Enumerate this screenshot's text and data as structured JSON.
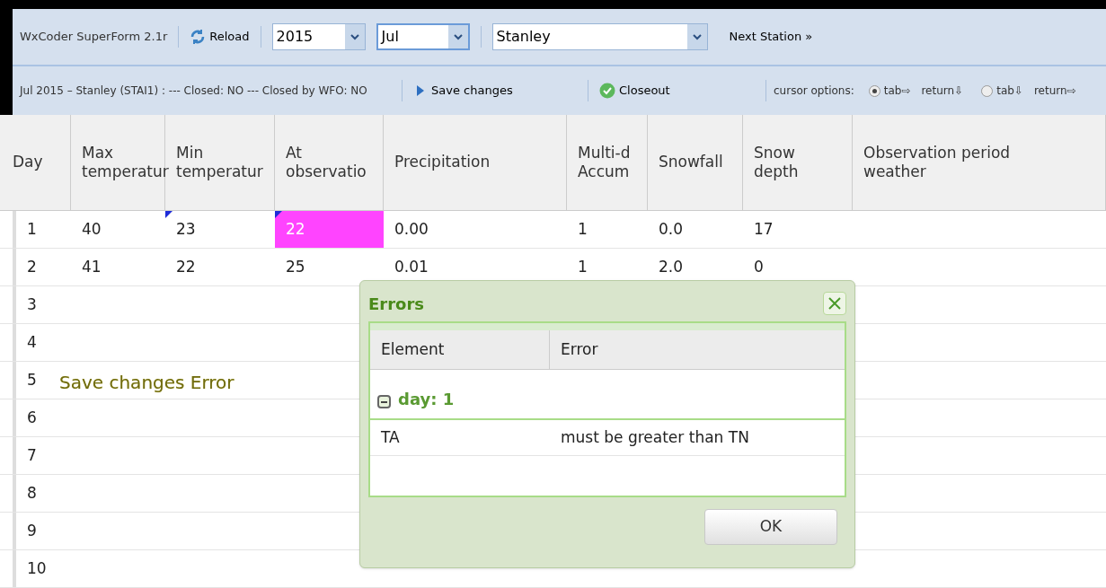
{
  "toolbar": {
    "app_title": "WxCoder SuperForm 2.1r",
    "reload": "Reload",
    "year": "2015",
    "month": "Jul",
    "station": "Stanley",
    "next_station": "Next Station",
    "next_icon": "»"
  },
  "status_bar": {
    "summary": "Jul 2015 – Stanley (STAI1) : --- Closed: NO --- Closed by WFO: NO",
    "save": "Save changes",
    "closeout": "Closeout",
    "cursor_label": "cursor options:",
    "cursor_options": [
      {
        "tab": "tab⇨",
        "return": "return⇩",
        "selected": true
      },
      {
        "tab": "tab⇩",
        "return": "return⇨",
        "selected": false
      }
    ]
  },
  "table": {
    "columns": [
      {
        "line1": "Day"
      },
      {
        "line1": "Max",
        "line2": "temperatur"
      },
      {
        "line1": "Min",
        "line2": "temperatur"
      },
      {
        "line1": "At",
        "line2": "observatio"
      },
      {
        "line1": "Precipitation"
      },
      {
        "line1": "Multi-d",
        "line2": "Accum"
      },
      {
        "line1": "Snowfall"
      },
      {
        "line1": "Snow",
        "line2": "depth"
      },
      {
        "line1": "Observation period",
        "line2": "weather"
      }
    ],
    "rows": [
      {
        "day": "1",
        "cells": [
          {
            "value": "40",
            "modified": false,
            "error": false
          },
          {
            "value": "23",
            "modified": true,
            "error": false
          },
          {
            "value": "22",
            "modified": true,
            "error": true
          },
          {
            "value": "0.00",
            "modified": false,
            "error": false
          },
          {
            "value": "1",
            "modified": false,
            "error": false
          },
          {
            "value": "0.0",
            "modified": false,
            "error": false
          },
          {
            "value": "17",
            "modified": false,
            "error": false
          }
        ]
      },
      {
        "day": "2",
        "cells": [
          {
            "value": "41",
            "modified": false,
            "error": false
          },
          {
            "value": "22",
            "modified": false,
            "error": false
          },
          {
            "value": "25",
            "modified": false,
            "error": false
          },
          {
            "value": "0.01",
            "modified": false,
            "error": false
          },
          {
            "value": "1",
            "modified": false,
            "error": false
          },
          {
            "value": "2.0",
            "modified": false,
            "error": false
          },
          {
            "value": "0",
            "modified": false,
            "error": false
          }
        ]
      },
      {
        "day": "3"
      },
      {
        "day": "4"
      },
      {
        "day": "5"
      },
      {
        "day": "6"
      },
      {
        "day": "7"
      },
      {
        "day": "8"
      },
      {
        "day": "9"
      },
      {
        "day": "10"
      }
    ]
  },
  "ghost_tooltip": "Save changes Error",
  "dialog": {
    "title": "Errors",
    "columns": [
      "Element",
      "Error"
    ],
    "group": {
      "label": "day: 1",
      "expanded": true
    },
    "errors": [
      {
        "element": "TA",
        "message": "must be greater than TN"
      }
    ],
    "ok": "OK"
  }
}
